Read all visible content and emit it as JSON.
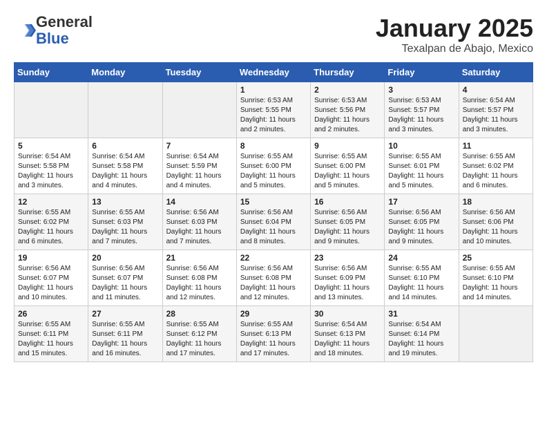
{
  "header": {
    "logo": {
      "line1": "General",
      "line2": "Blue"
    },
    "title": "January 2025",
    "location": "Texalpan de Abajo, Mexico"
  },
  "weekdays": [
    "Sunday",
    "Monday",
    "Tuesday",
    "Wednesday",
    "Thursday",
    "Friday",
    "Saturday"
  ],
  "weeks": [
    [
      {
        "day": "",
        "info": ""
      },
      {
        "day": "",
        "info": ""
      },
      {
        "day": "",
        "info": ""
      },
      {
        "day": "1",
        "info": "Sunrise: 6:53 AM\nSunset: 5:55 PM\nDaylight: 11 hours\nand 2 minutes."
      },
      {
        "day": "2",
        "info": "Sunrise: 6:53 AM\nSunset: 5:56 PM\nDaylight: 11 hours\nand 2 minutes."
      },
      {
        "day": "3",
        "info": "Sunrise: 6:53 AM\nSunset: 5:57 PM\nDaylight: 11 hours\nand 3 minutes."
      },
      {
        "day": "4",
        "info": "Sunrise: 6:54 AM\nSunset: 5:57 PM\nDaylight: 11 hours\nand 3 minutes."
      }
    ],
    [
      {
        "day": "5",
        "info": "Sunrise: 6:54 AM\nSunset: 5:58 PM\nDaylight: 11 hours\nand 3 minutes."
      },
      {
        "day": "6",
        "info": "Sunrise: 6:54 AM\nSunset: 5:58 PM\nDaylight: 11 hours\nand 4 minutes."
      },
      {
        "day": "7",
        "info": "Sunrise: 6:54 AM\nSunset: 5:59 PM\nDaylight: 11 hours\nand 4 minutes."
      },
      {
        "day": "8",
        "info": "Sunrise: 6:55 AM\nSunset: 6:00 PM\nDaylight: 11 hours\nand 5 minutes."
      },
      {
        "day": "9",
        "info": "Sunrise: 6:55 AM\nSunset: 6:00 PM\nDaylight: 11 hours\nand 5 minutes."
      },
      {
        "day": "10",
        "info": "Sunrise: 6:55 AM\nSunset: 6:01 PM\nDaylight: 11 hours\nand 5 minutes."
      },
      {
        "day": "11",
        "info": "Sunrise: 6:55 AM\nSunset: 6:02 PM\nDaylight: 11 hours\nand 6 minutes."
      }
    ],
    [
      {
        "day": "12",
        "info": "Sunrise: 6:55 AM\nSunset: 6:02 PM\nDaylight: 11 hours\nand 6 minutes."
      },
      {
        "day": "13",
        "info": "Sunrise: 6:55 AM\nSunset: 6:03 PM\nDaylight: 11 hours\nand 7 minutes."
      },
      {
        "day": "14",
        "info": "Sunrise: 6:56 AM\nSunset: 6:03 PM\nDaylight: 11 hours\nand 7 minutes."
      },
      {
        "day": "15",
        "info": "Sunrise: 6:56 AM\nSunset: 6:04 PM\nDaylight: 11 hours\nand 8 minutes."
      },
      {
        "day": "16",
        "info": "Sunrise: 6:56 AM\nSunset: 6:05 PM\nDaylight: 11 hours\nand 9 minutes."
      },
      {
        "day": "17",
        "info": "Sunrise: 6:56 AM\nSunset: 6:05 PM\nDaylight: 11 hours\nand 9 minutes."
      },
      {
        "day": "18",
        "info": "Sunrise: 6:56 AM\nSunset: 6:06 PM\nDaylight: 11 hours\nand 10 minutes."
      }
    ],
    [
      {
        "day": "19",
        "info": "Sunrise: 6:56 AM\nSunset: 6:07 PM\nDaylight: 11 hours\nand 10 minutes."
      },
      {
        "day": "20",
        "info": "Sunrise: 6:56 AM\nSunset: 6:07 PM\nDaylight: 11 hours\nand 11 minutes."
      },
      {
        "day": "21",
        "info": "Sunrise: 6:56 AM\nSunset: 6:08 PM\nDaylight: 11 hours\nand 12 minutes."
      },
      {
        "day": "22",
        "info": "Sunrise: 6:56 AM\nSunset: 6:08 PM\nDaylight: 11 hours\nand 12 minutes."
      },
      {
        "day": "23",
        "info": "Sunrise: 6:56 AM\nSunset: 6:09 PM\nDaylight: 11 hours\nand 13 minutes."
      },
      {
        "day": "24",
        "info": "Sunrise: 6:55 AM\nSunset: 6:10 PM\nDaylight: 11 hours\nand 14 minutes."
      },
      {
        "day": "25",
        "info": "Sunrise: 6:55 AM\nSunset: 6:10 PM\nDaylight: 11 hours\nand 14 minutes."
      }
    ],
    [
      {
        "day": "26",
        "info": "Sunrise: 6:55 AM\nSunset: 6:11 PM\nDaylight: 11 hours\nand 15 minutes."
      },
      {
        "day": "27",
        "info": "Sunrise: 6:55 AM\nSunset: 6:11 PM\nDaylight: 11 hours\nand 16 minutes."
      },
      {
        "day": "28",
        "info": "Sunrise: 6:55 AM\nSunset: 6:12 PM\nDaylight: 11 hours\nand 17 minutes."
      },
      {
        "day": "29",
        "info": "Sunrise: 6:55 AM\nSunset: 6:13 PM\nDaylight: 11 hours\nand 17 minutes."
      },
      {
        "day": "30",
        "info": "Sunrise: 6:54 AM\nSunset: 6:13 PM\nDaylight: 11 hours\nand 18 minutes."
      },
      {
        "day": "31",
        "info": "Sunrise: 6:54 AM\nSunset: 6:14 PM\nDaylight: 11 hours\nand 19 minutes."
      },
      {
        "day": "",
        "info": ""
      }
    ]
  ]
}
